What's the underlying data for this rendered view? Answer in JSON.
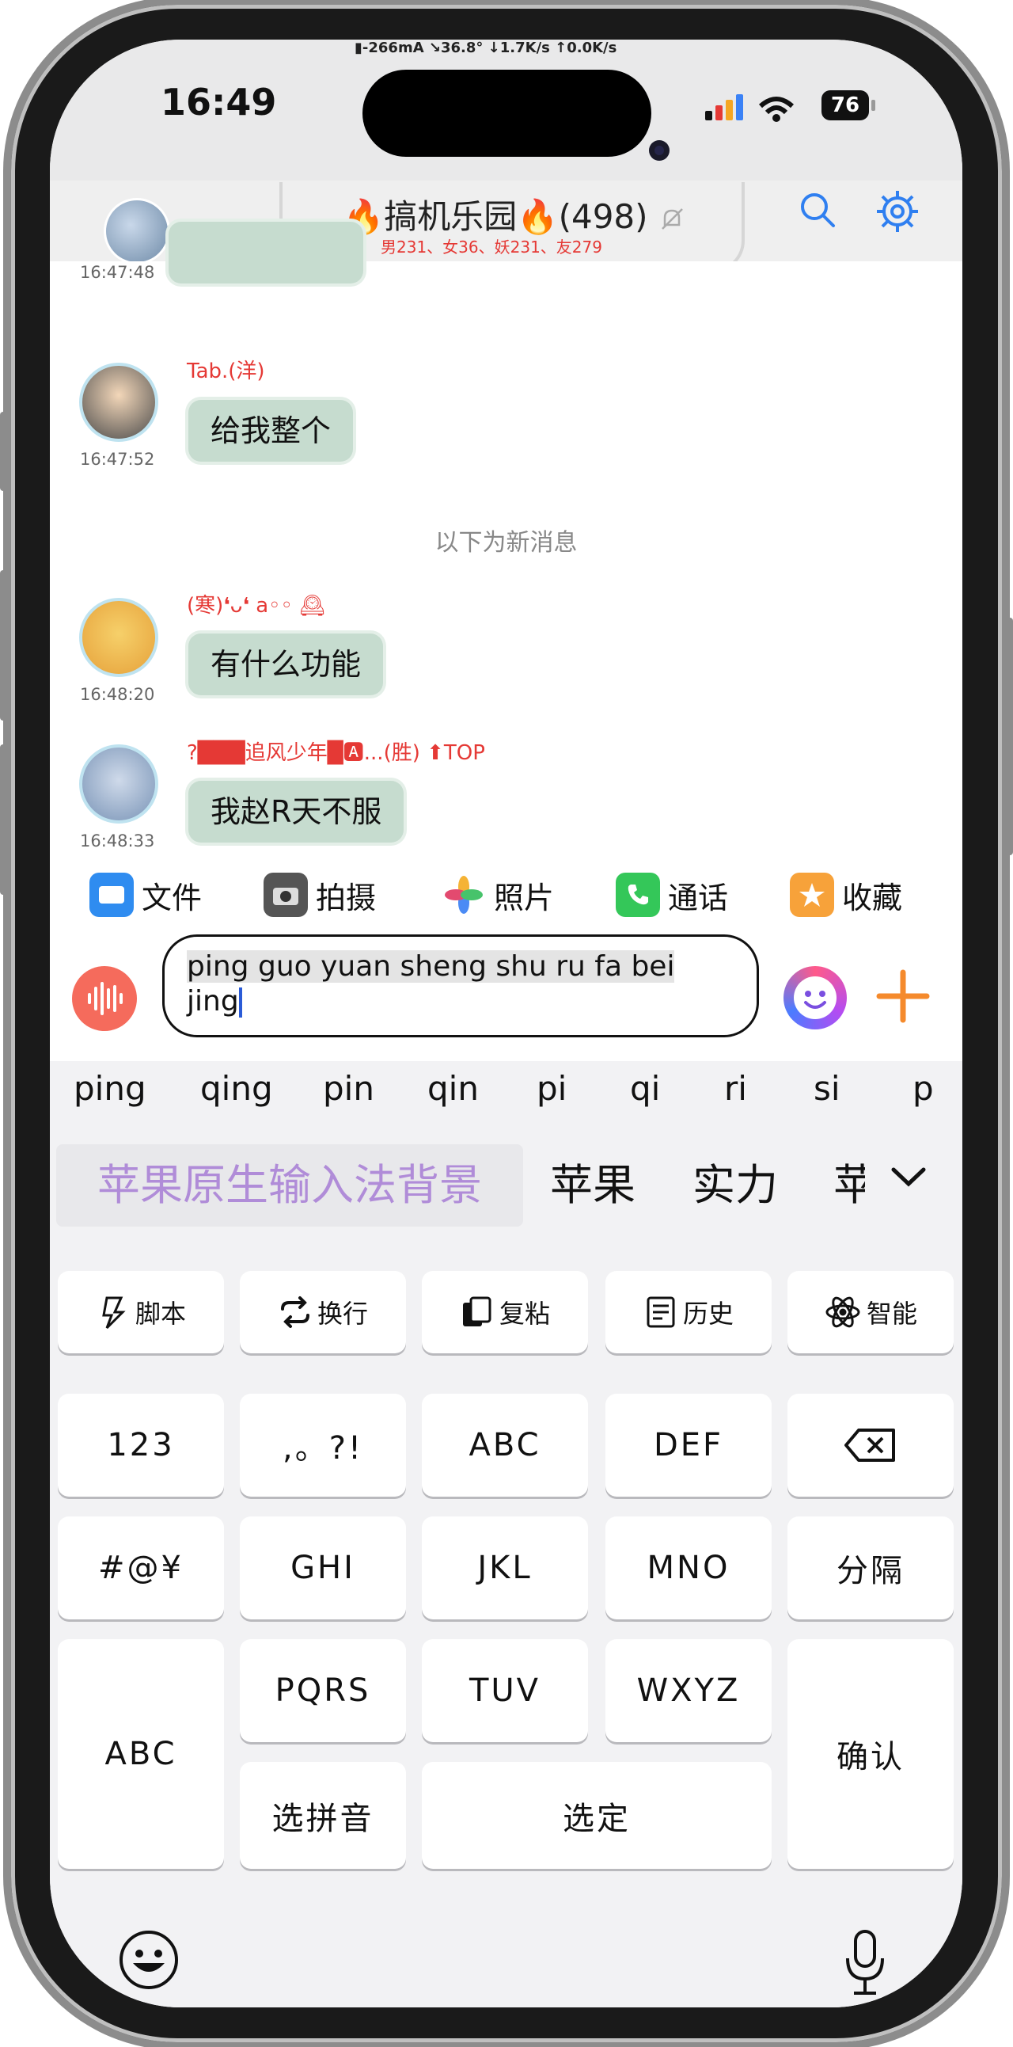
{
  "status": {
    "time": "16:49",
    "netinfo": "▮-266mA ↘36.8° ↓1.7K/s ↑0.0K/s",
    "battery": "76"
  },
  "header": {
    "title": "🔥搞机乐园🔥(498)",
    "subtitle": "男231、女36、妖231、友279"
  },
  "chat": {
    "messages": [
      {
        "time": "16:47:48",
        "name": "",
        "text": ""
      },
      {
        "time": "16:47:52",
        "name": "Tab.(洋)",
        "text": "给我整个"
      },
      {
        "time": "16:48:20",
        "name": "(寒)❛ᴗ❛ a◦◦ 🕰",
        "text": "有什么功能"
      },
      {
        "time": "16:48:33",
        "name": "?███追风少年█🅰...(胜) ⬆TOP",
        "text": "我赵R天不服"
      }
    ],
    "system_notice": "以下为新消息"
  },
  "toolbar": {
    "items": [
      {
        "label": "文件",
        "color": "#2f8cf0"
      },
      {
        "label": "拍摄",
        "color": "#555555"
      },
      {
        "label": "照片",
        "color": "#ffffff"
      },
      {
        "label": "通话",
        "color": "#34c759"
      },
      {
        "label": "收藏",
        "color": "#f7a23a"
      }
    ]
  },
  "input": {
    "value_highlighted": "ping guo yuan sheng shu ru fa bei",
    "value_tail": "jing"
  },
  "keyboard": {
    "candidates": [
      "ping",
      "qing",
      "pin",
      "qin",
      "pi",
      "qi",
      "ri",
      "si",
      "p"
    ],
    "phrase_main": "苹果原生输入法背景",
    "phrases": [
      "苹果",
      "实力",
      "苹"
    ],
    "function_keys": [
      "脚本",
      "换行",
      "复粘",
      "历史",
      "智能"
    ],
    "row1": [
      "123",
      ",。?!",
      "ABC",
      "DEF"
    ],
    "row2": [
      "#@¥",
      "GHI",
      "JKL",
      "MNO",
      "分隔"
    ],
    "row3": [
      "PQRS",
      "TUV",
      "WXYZ"
    ],
    "left_abc": "ABC",
    "confirm": "确认",
    "select_pinyin": "选拼音",
    "select": "选定"
  }
}
